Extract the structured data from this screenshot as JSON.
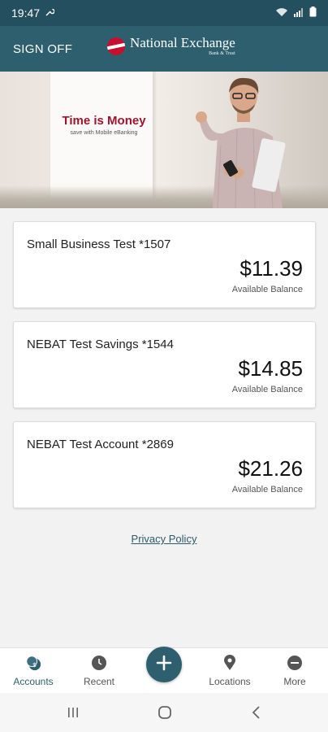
{
  "status_bar": {
    "time": "19:47"
  },
  "header": {
    "sign_off_label": "SIGN OFF",
    "logo_name": "National Exchange",
    "logo_sub": "Bank & Trust"
  },
  "banner": {
    "headline": "Time is Money",
    "subtext": "save with Mobile eBanking"
  },
  "accounts": [
    {
      "name": "Small Business Test *1507",
      "balance": "$11.39",
      "balance_label": "Available Balance"
    },
    {
      "name": "NEBAT Test Savings *1544",
      "balance": "$14.85",
      "balance_label": "Available Balance"
    },
    {
      "name": "NEBAT Test Account *2869",
      "balance": "$21.26",
      "balance_label": "Available Balance"
    }
  ],
  "privacy_link": "Privacy Policy",
  "bottom_nav": {
    "items": [
      {
        "label": "Accounts",
        "icon": "accounts-icon",
        "active": true
      },
      {
        "label": "Recent",
        "icon": "clock-icon",
        "active": false
      },
      {
        "label": "Locations",
        "icon": "location-pin-icon",
        "active": false
      },
      {
        "label": "More",
        "icon": "more-icon",
        "active": false
      }
    ],
    "fab_icon": "plus-icon"
  },
  "colors": {
    "header": "#2e5f6f",
    "status_bar": "#234f5f",
    "brand_red": "#c8102e",
    "accent": "#2e5f6f"
  }
}
